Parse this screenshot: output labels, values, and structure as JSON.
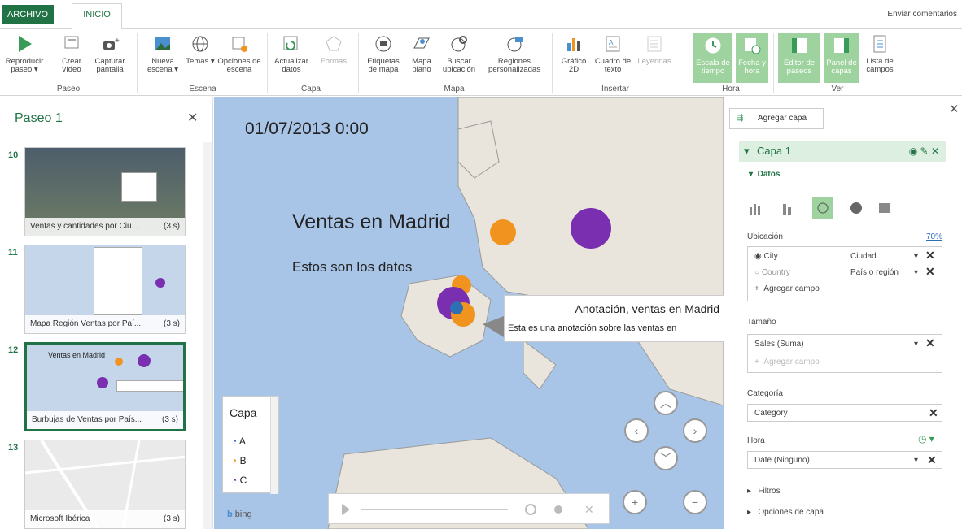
{
  "ribbon": {
    "tabs": {
      "archivo": "ARCHIVO",
      "inicio": "INICIO"
    },
    "feedback": "Enviar comentarios",
    "buttons": {
      "play_tour": "Reproducir paseo ▾",
      "create_video": "Crear vídeo",
      "capture_screen": "Capturar pantalla",
      "new_scene": "Nueva escena ▾",
      "themes": "Temas ▾",
      "scene_options": "Opciones de escena",
      "refresh_data": "Actualizar datos",
      "shapes": "Formas",
      "map_labels": "Etiquetas de mapa",
      "flat_map": "Mapa plano",
      "find_location": "Buscar ubicación",
      "custom_regions": "Regiones personalizadas",
      "chart_2d": "Gráfico 2D",
      "text_box": "Cuadro de texto",
      "legends": "Leyendas",
      "time_line": "Escala de tiempo",
      "date_time": "Fecha y hora",
      "tour_editor": "Editor de paseos",
      "layer_pane": "Panel de capas",
      "field_list": "Lista de campos"
    },
    "groups": {
      "tour": "Paseo",
      "scene": "Escena",
      "layer": "Capa",
      "map": "Mapa",
      "insert": "Insertar",
      "time": "Hora",
      "view": "Ver"
    }
  },
  "tour": {
    "title": "Paseo 1",
    "scenes": [
      {
        "num": "10",
        "label": "Ventas y cantidades por Ciu...",
        "dur": "(3 s)"
      },
      {
        "num": "11",
        "label": "Mapa Región Ventas por Paí...",
        "dur": "(3 s)"
      },
      {
        "num": "12",
        "label": "Burbujas de Ventas por País...",
        "dur": "(3 s)"
      },
      {
        "num": "13",
        "label": "Microsoft Ibérica",
        "dur": "(3 s)"
      }
    ]
  },
  "map": {
    "datetime": "01/07/2013 0:00",
    "title": "Ventas en Madrid",
    "subtitle": "Estos son los datos",
    "annotation_title": "Anotación, ventas en Madrid",
    "annotation_body": "Esta es una anotación sobre las ventas en",
    "legend": {
      "title": "Capa",
      "items": [
        "A",
        "B",
        "C"
      ],
      "colors": [
        "#2f6fb3",
        "#f0941f",
        "#7a2fb0"
      ]
    },
    "bing": "bing"
  },
  "layers": {
    "add_layer": "Agregar capa",
    "layer_name": "Capa 1",
    "data_section": "Datos",
    "location_label": "Ubicación",
    "location_pct": "70%",
    "location_fields": [
      {
        "field": "City",
        "type": "Ciudad"
      },
      {
        "field": "Country",
        "type": "País o región"
      }
    ],
    "add_field": "Agregar campo",
    "size_label": "Tamaño",
    "size_value": "Sales (Suma)",
    "category_label": "Categoría",
    "category_value": "Category",
    "time_label": "Hora",
    "time_value": "Date (Ninguno)",
    "filters": "Filtros",
    "layer_options": "Opciones de capa"
  }
}
